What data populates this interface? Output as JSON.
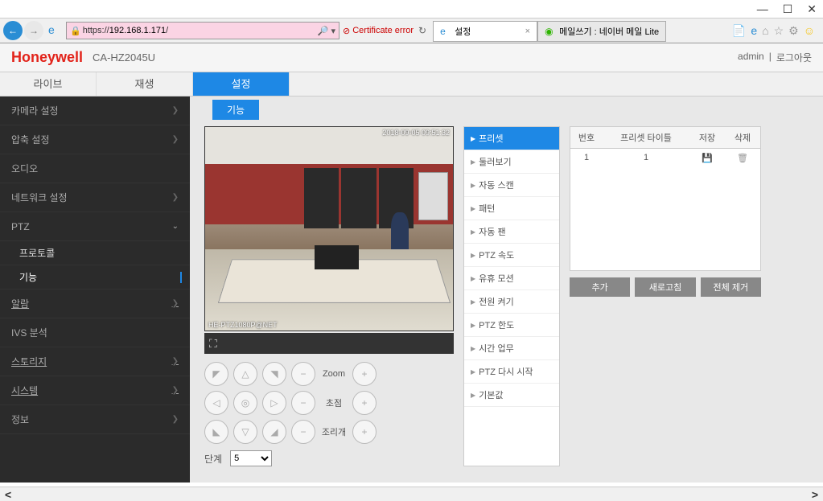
{
  "window": {
    "url_prefix": "https://",
    "url_host": "192.168.1.171",
    "url_path": "/",
    "cert_error": "Certificate error"
  },
  "tabs": [
    {
      "title": "설정",
      "favicon": "ie"
    },
    {
      "title": "메일쓰기 : 네이버 메일 Lite",
      "favicon": "naver"
    }
  ],
  "brand": "Honeywell",
  "model": "CA-HZ2045U",
  "user": "admin",
  "logout": "로그아웃",
  "main_tabs": {
    "live": "라이브",
    "play": "재생",
    "setup": "설정"
  },
  "sidebar": {
    "camera": "카메라 설정",
    "compress": "압축 설정",
    "audio": "오디오",
    "network": "네트워크 설정",
    "ptz": "PTZ",
    "protocol": "프로토콜",
    "function": "기능",
    "alarm": "알람",
    "ivs": "IVS 분석",
    "storage": "스토리지",
    "system": "시스템",
    "info": "정보"
  },
  "func_tab": "기능",
  "osd_text": "HE-PTZ1080P@NET",
  "osd_time": "2018-09-05 09:51:32",
  "ptz": {
    "zoom": "Zoom",
    "focus": "초점",
    "iris": "조리개",
    "step": "단계",
    "step_value": "5"
  },
  "func_list": [
    "프리셋",
    "둘러보기",
    "자동 스캔",
    "패턴",
    "자동 팬",
    "PTZ 속도",
    "유휴 모션",
    "전원 켜기",
    "PTZ 한도",
    "시간 업무",
    "PTZ 다시 시작",
    "기본값"
  ],
  "preset": {
    "headers": {
      "num": "번호",
      "title": "프리셋 타이틀",
      "save": "저장",
      "del": "삭제"
    },
    "rows": [
      {
        "num": "1",
        "title": "1"
      }
    ],
    "buttons": {
      "add": "추가",
      "refresh": "새로고침",
      "remove_all": "전체 제거"
    }
  }
}
